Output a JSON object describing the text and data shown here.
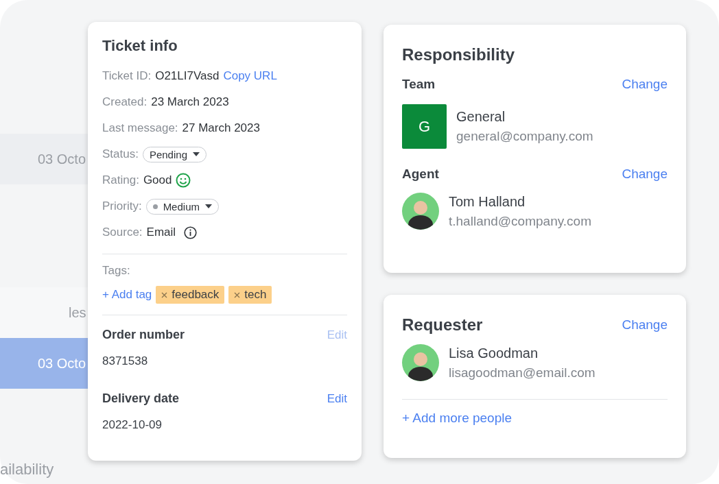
{
  "background": {
    "rows": [
      {
        "kind": "date",
        "text": "03 Octo",
        "selected": false
      },
      {
        "kind": "note",
        "text": "les",
        "selected": false
      },
      {
        "kind": "date",
        "text": "03 Octo",
        "selected": true
      }
    ],
    "footer": "ailability"
  },
  "ticket_info": {
    "title": "Ticket info",
    "fields": [
      {
        "kind": "text",
        "label": "Ticket ID:",
        "value": "O21LI7Vasd",
        "link": "Copy URL"
      },
      {
        "kind": "text",
        "label": "Created:",
        "value": "23 March 2023"
      },
      {
        "kind": "text",
        "label": "Last message:",
        "value": "27 March 2023"
      },
      {
        "kind": "dropdown",
        "label": "Status:",
        "value": "Pending"
      },
      {
        "kind": "rating",
        "label": "Rating:",
        "value": "Good"
      },
      {
        "kind": "dropdown_dot",
        "label": "Priority:",
        "value": "Medium"
      },
      {
        "kind": "info",
        "label": "Source:",
        "value": "Email"
      }
    ],
    "tags_label": "Tags:",
    "add_tag": "+ Add tag",
    "tags": [
      "feedback",
      "tech"
    ],
    "sections": [
      {
        "title": "Order number",
        "edit": "Edit",
        "disabled": true,
        "value": "8371538"
      },
      {
        "title": "Delivery date",
        "edit": "Edit",
        "disabled": false,
        "value": "2022-10-09"
      }
    ]
  },
  "responsibility": {
    "title": "Responsibility",
    "groups": [
      {
        "label": "Team",
        "change": "Change",
        "initial": "G",
        "name": "General",
        "email": "general@company.com"
      },
      {
        "label": "Agent",
        "change": "Change",
        "name": "Tom Halland",
        "email": "t.halland@company.com"
      }
    ]
  },
  "requester": {
    "title": "Requester",
    "change": "Change",
    "name": "Lisa Goodman",
    "email": "lisagoodman@email.com",
    "add_more": "+ Add more people"
  }
}
